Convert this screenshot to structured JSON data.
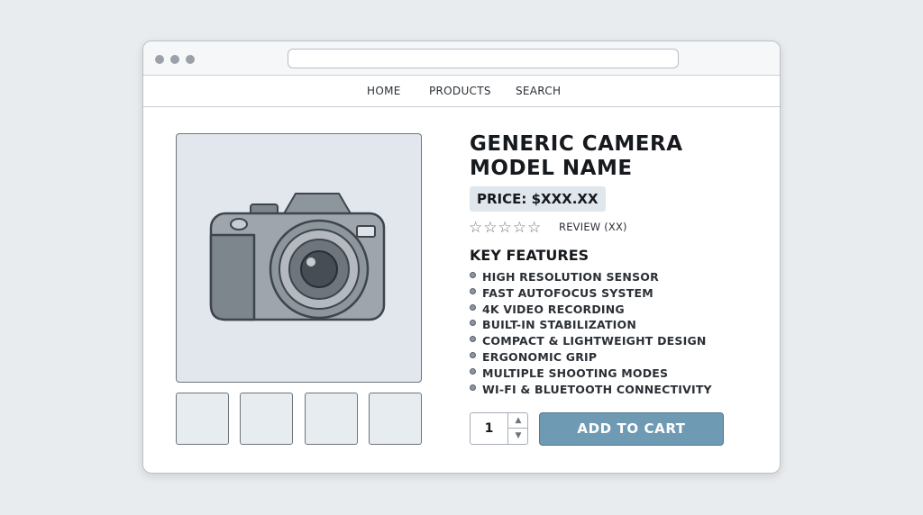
{
  "nav": {
    "home": "HOME",
    "products": "PRODUCTS",
    "search": "SEARCH"
  },
  "product": {
    "title_line1": "GENERIC CAMERA",
    "title_line2": "MODEL NAME",
    "price": "PRICE: $XXX.XX",
    "rating_filled_stars": 0,
    "rating_max": 5,
    "review_text": "REVIEW (XX)",
    "main_image_icon": "camera-icon"
  },
  "features": {
    "heading": "KEY FEATURES",
    "items": [
      "HIGH RESOLUTION SENSOR",
      "FAST AUTOFOCUS SYSTEM",
      "4K VIDEO RECORDING",
      "BUILT-IN STABILIZATION",
      "COMPACT & LIGHTWEIGHT DESIGN",
      "ERGONOMIC GRIP",
      "MULTIPLE SHOOTING MODES",
      "WI-FI & BLUETOOTH CONNECTIVITY"
    ]
  },
  "purchase": {
    "quantity": "1",
    "add_to_cart_label": "ADD TO CART"
  },
  "colors": {
    "accent": "#6f9ab4",
    "background": "#e9ecef",
    "image_placeholder": "#e1e7ec"
  }
}
